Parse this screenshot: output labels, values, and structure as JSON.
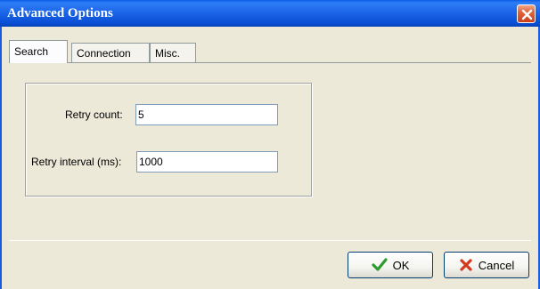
{
  "window": {
    "title": "Advanced Options",
    "close_icon": "close-icon"
  },
  "tabs": [
    {
      "label": "Search",
      "active": true
    },
    {
      "label": "Connection",
      "active": false
    },
    {
      "label": "Misc.",
      "active": false
    }
  ],
  "search": {
    "retry_count_label": "Retry count:",
    "retry_count_value": "5",
    "retry_interval_label": "Retry interval (ms):",
    "retry_interval_value": "1000"
  },
  "buttons": {
    "ok_label": "OK",
    "ok_icon": "checkmark-icon",
    "cancel_label": "Cancel",
    "cancel_icon": "x-icon"
  },
  "colors": {
    "title_bar": "#1c66e8",
    "dialog_bg": "#ece9d8",
    "close_button": "#e2643c",
    "ok_check": "#2e9b2e",
    "cancel_x": "#d23a1e"
  }
}
